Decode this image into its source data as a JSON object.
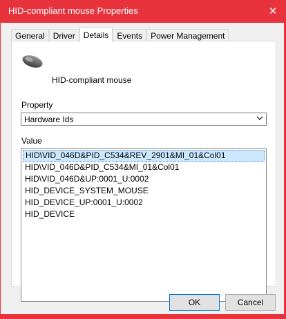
{
  "window": {
    "title": "HID-compliant mouse Properties"
  },
  "tabs": [
    {
      "label": "General"
    },
    {
      "label": "Driver"
    },
    {
      "label": "Details"
    },
    {
      "label": "Events"
    },
    {
      "label": "Power Management"
    }
  ],
  "active_tab": "Details",
  "device": {
    "name": "HID-compliant mouse",
    "icon": "mouse-icon"
  },
  "property": {
    "label": "Property",
    "selected": "Hardware Ids"
  },
  "value": {
    "label": "Value",
    "items": [
      "HID\\VID_046D&PID_C534&REV_2901&MI_01&Col01",
      "HID\\VID_046D&PID_C534&MI_01&Col01",
      "HID\\VID_046D&UP:0001_U:0002",
      "HID_DEVICE_SYSTEM_MOUSE",
      "HID_DEVICE_UP:0001_U:0002",
      "HID_DEVICE"
    ]
  },
  "buttons": {
    "ok": "OK",
    "cancel": "Cancel"
  },
  "colors": {
    "titlebar": "#e8323c",
    "selection": "#cce8ff"
  }
}
